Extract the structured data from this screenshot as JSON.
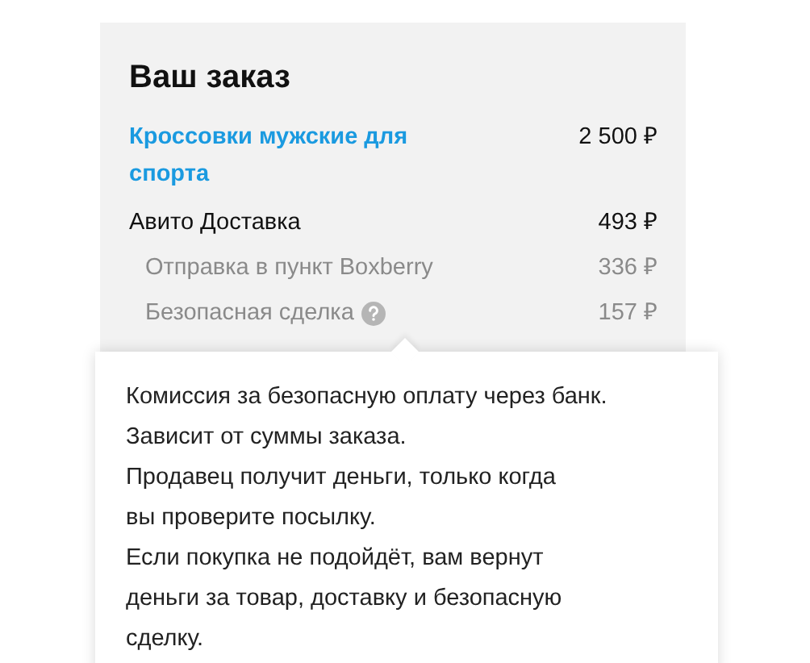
{
  "title": "Ваш заказ",
  "items": [
    {
      "kind": "product",
      "label": "Кроссовки мужские для спорта",
      "price": "2 500 ₽"
    },
    {
      "kind": "main",
      "label": "Авито Доставка",
      "price": "493 ₽"
    },
    {
      "kind": "sub",
      "label": "Отправка в пункт Boxberry",
      "price": "336 ₽"
    },
    {
      "kind": "sub",
      "label": "Безопасная сделка",
      "price": "157 ₽",
      "help": true
    }
  ],
  "tooltip": {
    "text": "Комиссия за безопасную оплату через банк.\nЗависит от суммы заказа.\nПродавец получит деньги, только когда\nвы проверите посылку.\nЕсли покупка не подойдёт, вам вернут\nденьги за товар, доставку и безопасную\nсделку."
  }
}
